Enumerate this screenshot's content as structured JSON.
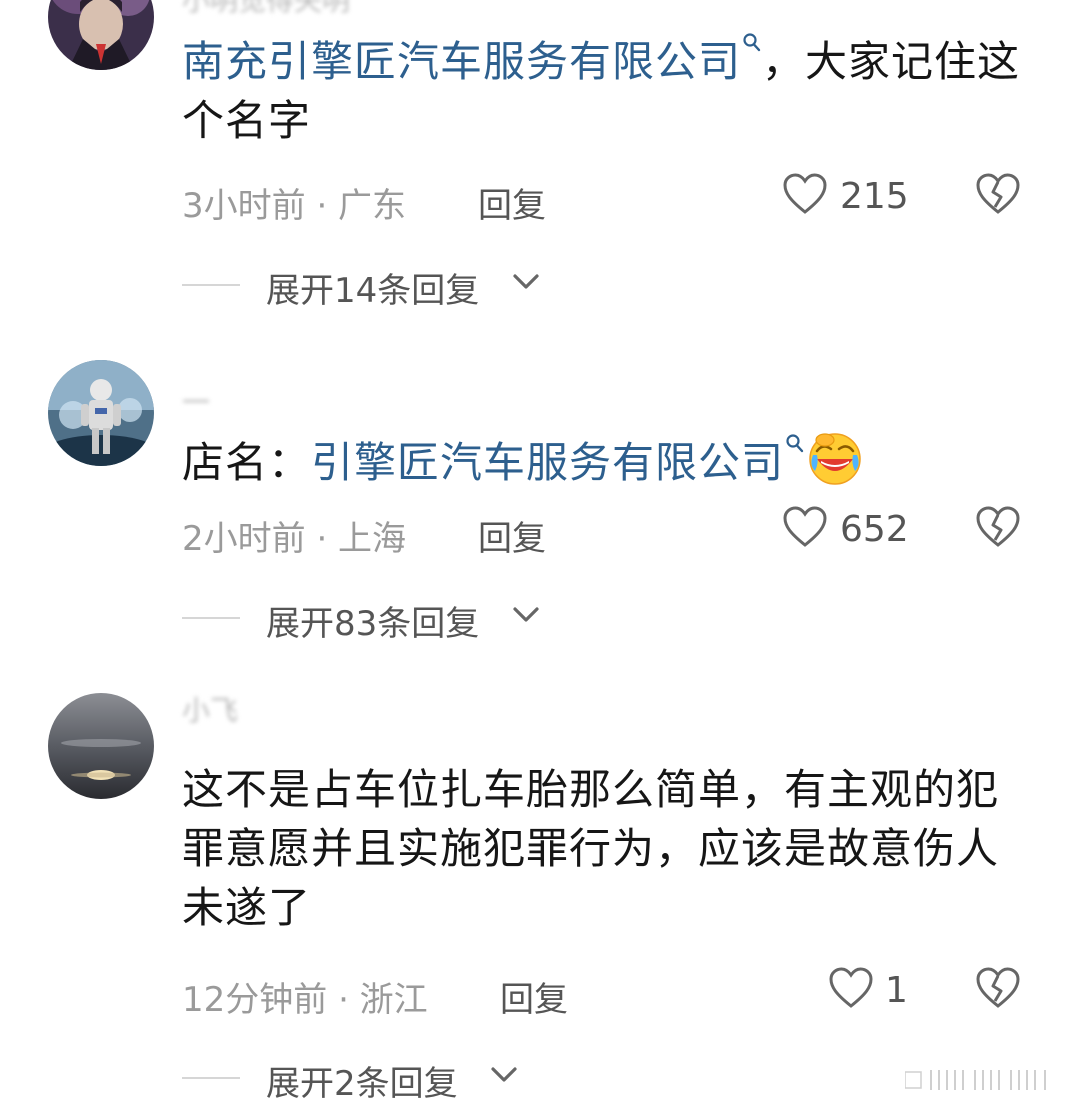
{
  "comments": [
    {
      "username": "小明觉得失明",
      "link_text": "南充引擎匠汽车服务有限公司",
      "text_after_link": "，大家记住这个名字",
      "time_location": "3小时前 · 广东",
      "reply_label": "回复",
      "like_count": "215",
      "expand_label": "展开14条回复"
    },
    {
      "username": "一",
      "text_before_link": "店名：",
      "link_text": "引擎匠汽车服务有限公司",
      "time_location": "2小时前 · 上海",
      "reply_label": "回复",
      "like_count": "652",
      "expand_label": "展开83条回复",
      "emoji": "laughing-crying-emoji"
    },
    {
      "username": "小飞",
      "text": "这不是占车位扎车胎那么简单，有主观的犯罪意愿并且实施犯罪行为，应该是故意伤人未遂了",
      "time_location": "12分钟前 · 浙江",
      "reply_label": "回复",
      "like_count": "1",
      "expand_label": "展开2条回复"
    }
  ],
  "icons": {
    "like": "heart-outline-icon",
    "dislike": "broken-heart-icon",
    "expand": "chevron-down-icon",
    "link": "search-icon"
  },
  "colors": {
    "link": "#2d5f8e",
    "meta": "#9a9a9a",
    "text": "#161616",
    "action": "#555555"
  }
}
